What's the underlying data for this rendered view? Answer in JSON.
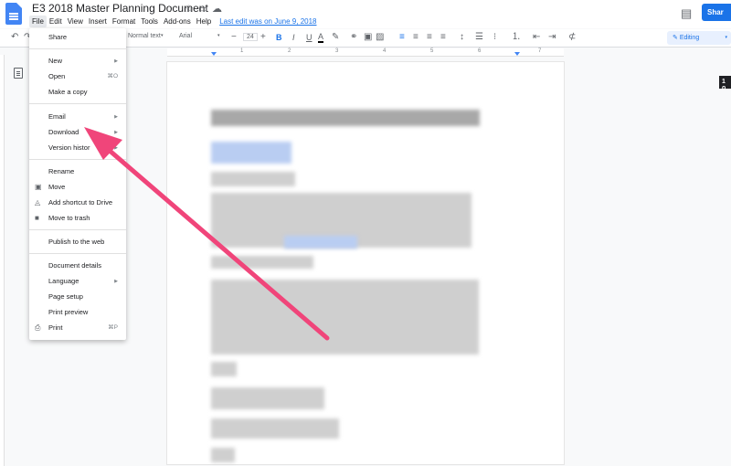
{
  "header": {
    "doc_title": "E3 2018 Master Planning Document",
    "menu": {
      "file": "File",
      "edit": "Edit",
      "view": "View",
      "insert": "Insert",
      "format": "Format",
      "tools": "Tools",
      "addons": "Add-ons",
      "help": "Help"
    },
    "last_edit": "Last edit was on June 9, 2018",
    "share_label": "Shar"
  },
  "toolbar": {
    "style": "Normal text",
    "font": "Arial",
    "size": "24",
    "minus": "−",
    "plus": "+",
    "bold": "B",
    "italic": "I",
    "underline": "U",
    "text_color": "A",
    "mode": "Editing"
  },
  "ruler": {
    "ticks": [
      "1",
      "2",
      "3",
      "4",
      "5",
      "6",
      "7"
    ]
  },
  "page_indicator": "1 o",
  "file_menu": {
    "share": "Share",
    "new": "New",
    "open": "Open",
    "open_shortcut": "⌘O",
    "make_copy": "Make a copy",
    "email": "Email",
    "download": "Download",
    "version_history": "Version histor",
    "rename": "Rename",
    "move": "Move",
    "add_shortcut": "Add shortcut to Drive",
    "move_to_trash": "Move to trash",
    "publish": "Publish to the web",
    "document_details": "Document details",
    "language": "Language",
    "page_setup": "Page setup",
    "print_preview": "Print preview",
    "print": "Print",
    "print_shortcut": "⌘P"
  },
  "colors": {
    "accent": "#1a73e8",
    "arrow": "#f0457a",
    "doc_icon": "#4285f4"
  },
  "icons": {
    "star": "star-icon",
    "folder": "folder-icon",
    "cloud": "cloud-icon",
    "comment": "comment-icon",
    "outline": "outline-icon"
  }
}
